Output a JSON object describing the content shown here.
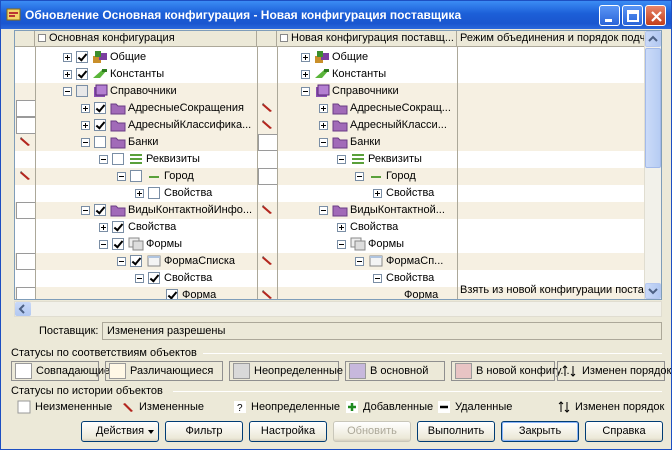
{
  "window": {
    "title": "Обновление Основная конфигурация - Новая конфигурация поставщика"
  },
  "columns": {
    "main": "Основная конфигурация",
    "supplier": "Новая конфигурация поставщ...",
    "mode": "Режим объединения и порядок подчи"
  },
  "tree_left": [
    {
      "label": "Общие"
    },
    {
      "label": "Константы"
    },
    {
      "label": "Справочники"
    },
    {
      "label": "АдресныеСокращения"
    },
    {
      "label": "АдресныйКлассифика..."
    },
    {
      "label": "Банки"
    },
    {
      "label": "Реквизиты"
    },
    {
      "label": "Город"
    },
    {
      "label": "Свойства"
    },
    {
      "label": "ВидыКонтактнойИнфо..."
    },
    {
      "label": "Свойства"
    },
    {
      "label": "Формы"
    },
    {
      "label": "ФормаСписка"
    },
    {
      "label": "Свойства"
    },
    {
      "label": "Форма"
    }
  ],
  "tree_right": [
    {
      "label": "Общие"
    },
    {
      "label": "Константы"
    },
    {
      "label": "Справочники"
    },
    {
      "label": "АдресныеСокращ..."
    },
    {
      "label": "АдресныйКласси..."
    },
    {
      "label": "Банки"
    },
    {
      "label": "Реквизиты"
    },
    {
      "label": "Город"
    },
    {
      "label": "Свойства"
    },
    {
      "label": "ВидыКонтактной..."
    },
    {
      "label": "Свойства"
    },
    {
      "label": "Формы"
    },
    {
      "label": "ФормаСп..."
    },
    {
      "label": "Свойства"
    },
    {
      "label": "Форма"
    }
  ],
  "mode_value": "Взять из новой конфигурации постав",
  "supplier": {
    "label": "Поставщик:",
    "value": "Изменения разрешены"
  },
  "status_match": {
    "title": "Статусы по соответствиям объектов",
    "items": [
      "Совпадающие",
      "Различающиеся",
      "Неопределенные",
      "В основной",
      "В новой конфигу...",
      "Изменен порядок"
    ],
    "colors": [
      "#ffffff",
      "#fff8e6",
      "#d9d9d9",
      "#c7b8dc",
      "#e8c4c4",
      "#ffffff"
    ]
  },
  "status_history": {
    "title": "Статусы по истории объектов",
    "items": [
      "Неизмененные",
      "Измененные",
      "Неопределенные",
      "Добавленные",
      "Удаленные",
      "Изменен порядок"
    ]
  },
  "buttons": {
    "actions": "Действия",
    "filter": "Фильтр",
    "settings": "Настройка",
    "refresh": "Обновить",
    "execute": "Выполнить",
    "close": "Закрыть",
    "help": "Справка"
  }
}
